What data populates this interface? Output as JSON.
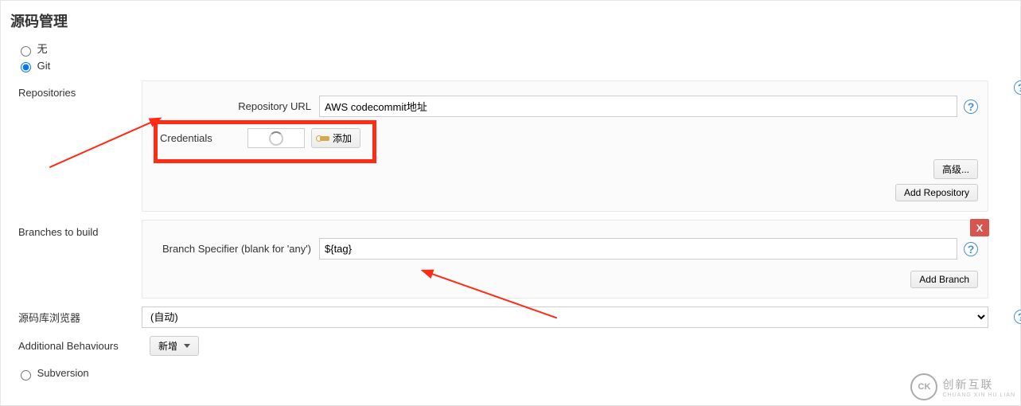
{
  "section_title": "源码管理",
  "scm_options": {
    "none": "无",
    "git": "Git",
    "svn": "Subversion",
    "selected": "git"
  },
  "repositories": {
    "label": "Repositories",
    "url_label": "Repository URL",
    "url_value": "AWS codecommit地址",
    "credentials_label": "Credentials",
    "add_btn": "添加",
    "advanced_btn": "高级...",
    "add_repo_btn": "Add Repository"
  },
  "branches": {
    "label": "Branches to build",
    "specifier_label": "Branch Specifier (blank for 'any')",
    "specifier_value": "${tag}",
    "add_branch_btn": "Add Branch",
    "delete_x": "X"
  },
  "repo_browser": {
    "label": "源码库浏览器",
    "value": "(自动)"
  },
  "additional": {
    "label": "Additional Behaviours",
    "btn": "新增"
  },
  "help_glyph": "?",
  "logo": {
    "main": "创新互联",
    "sub": "CHUANG XIN HU LIAN",
    "mark": "CK"
  }
}
